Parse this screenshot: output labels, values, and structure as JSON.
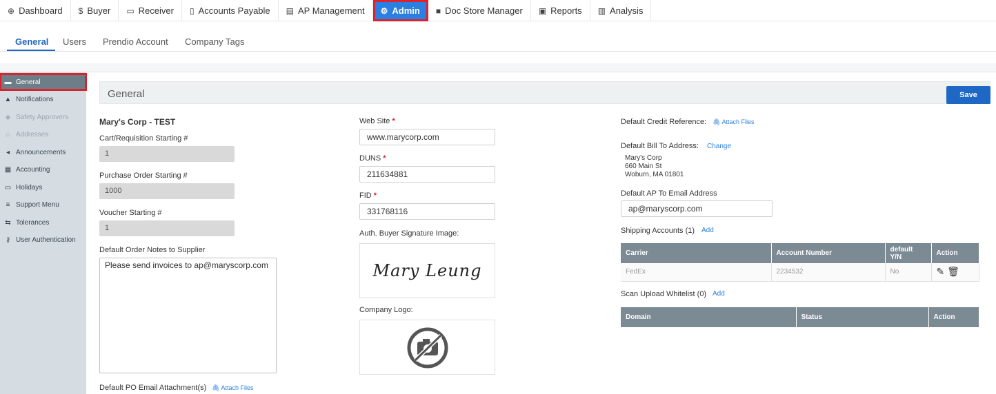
{
  "topnav": {
    "items": [
      {
        "label": "Dashboard",
        "icon": "dashboard-icon",
        "glyph": "⊕"
      },
      {
        "label": "Buyer",
        "icon": "dollar-icon",
        "glyph": "$"
      },
      {
        "label": "Receiver",
        "icon": "box-icon",
        "glyph": "▭"
      },
      {
        "label": "Accounts Payable",
        "icon": "document-icon",
        "glyph": "▯"
      },
      {
        "label": "AP Management",
        "icon": "calculator-icon",
        "glyph": "▤"
      },
      {
        "label": "Admin",
        "icon": "gear-icon",
        "glyph": "⚙"
      },
      {
        "label": "Doc Store Manager",
        "icon": "doc-store-icon",
        "glyph": "■"
      },
      {
        "label": "Reports",
        "icon": "report-icon",
        "glyph": "▣"
      },
      {
        "label": "Analysis",
        "icon": "bar-chart-icon",
        "glyph": "▥"
      }
    ],
    "active_index": 5
  },
  "subtabs": [
    "General",
    "Users",
    "Prendio Account",
    "Company Tags"
  ],
  "sidebar": {
    "items": [
      {
        "label": "General",
        "icon": "briefcase-icon",
        "glyph": "▬",
        "state": "active"
      },
      {
        "label": "Notifications",
        "icon": "bell-icon",
        "glyph": "▲",
        "state": "normal"
      },
      {
        "label": "Safety Approvers",
        "icon": "shield-icon",
        "glyph": "◈",
        "state": "disabled"
      },
      {
        "label": "Addresses",
        "icon": "home-icon",
        "glyph": "⌂",
        "state": "disabled"
      },
      {
        "label": "Announcements",
        "icon": "megaphone-icon",
        "glyph": "◂",
        "state": "normal"
      },
      {
        "label": "Accounting",
        "icon": "ledger-icon",
        "glyph": "▦",
        "state": "normal"
      },
      {
        "label": "Holidays",
        "icon": "calendar-icon",
        "glyph": "▭",
        "state": "normal"
      },
      {
        "label": "Support Menu",
        "icon": "menu-icon",
        "glyph": "≡",
        "state": "normal"
      },
      {
        "label": "Tolerances",
        "icon": "sliders-icon",
        "glyph": "⇆",
        "state": "normal"
      },
      {
        "label": "User Authentication",
        "icon": "key-icon",
        "glyph": "⚷",
        "state": "normal"
      }
    ]
  },
  "panel": {
    "title": "General",
    "save_label": "Save"
  },
  "left_col": {
    "company": "Mary's Corp - TEST",
    "cart_label": "Cart/Requisition Starting #",
    "cart_value": "1",
    "po_label": "Purchase Order Starting #",
    "po_value": "1000",
    "voucher_label": "Voucher Starting #",
    "voucher_value": "1",
    "notes_label": "Default Order Notes to Supplier",
    "notes_value": "Please send invoices to ap@maryscorp.com",
    "po_email_label": "Default PO Email Attachment(s)",
    "attach_label": "Attach Files"
  },
  "mid_col": {
    "website_label": "Web Site",
    "website_value": "www.marycorp.com",
    "duns_label": "DUNS",
    "duns_value": "211634881",
    "fid_label": "FID",
    "fid_value": "331768116",
    "required_mark": "*",
    "signature_label": "Auth. Buyer Signature Image:",
    "signature_text": "Mary Leung",
    "logo_label": "Company Logo:"
  },
  "right_col": {
    "credit_label": "Default Credit Reference:",
    "attach_label": "Attach Files",
    "bill_to_label": "Default Bill To Address:",
    "change_label": "Change",
    "address_lines": [
      "Mary's Corp",
      "660 Main St",
      "Woburn, MA 01801"
    ],
    "ap_email_label": "Default AP To Email Address",
    "ap_email_value": "ap@maryscorp.com",
    "shipping_label": "Shipping Accounts (1)",
    "add_label": "Add",
    "shipping_headers": [
      "Carrier",
      "Account Number",
      "default Y/N",
      "Action"
    ],
    "shipping_rows": [
      [
        "FedEx",
        "2234532",
        "No"
      ]
    ],
    "scan_label": "Scan Upload Whitelist (0)",
    "scan_headers": [
      "Domain",
      "Status",
      "Action"
    ]
  }
}
